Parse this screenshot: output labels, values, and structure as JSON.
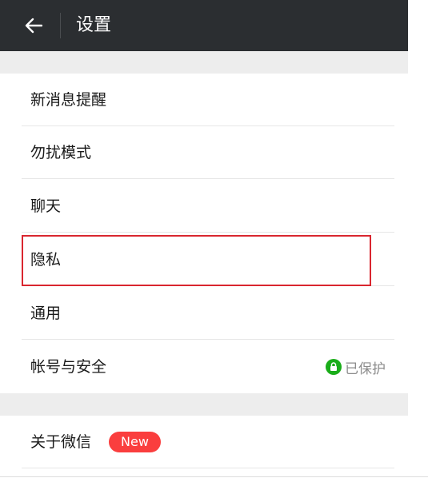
{
  "header": {
    "title": "设置",
    "back_icon": "arrow-left-icon",
    "background": "#2b2e31"
  },
  "menu": {
    "items": [
      {
        "label": "新消息提醒"
      },
      {
        "label": "勿扰模式"
      },
      {
        "label": "聊天"
      },
      {
        "label": "隐私"
      },
      {
        "label": "通用"
      },
      {
        "label": "帐号与安全",
        "status": "已保护",
        "status_icon": "lock-icon"
      },
      {
        "label": "关于微信",
        "badge": "New"
      }
    ]
  },
  "colors": {
    "section_gap": "#ededed",
    "highlight": "#d9262f",
    "protect_green": "#1aad19",
    "badge_red": "#fa3e3e"
  }
}
